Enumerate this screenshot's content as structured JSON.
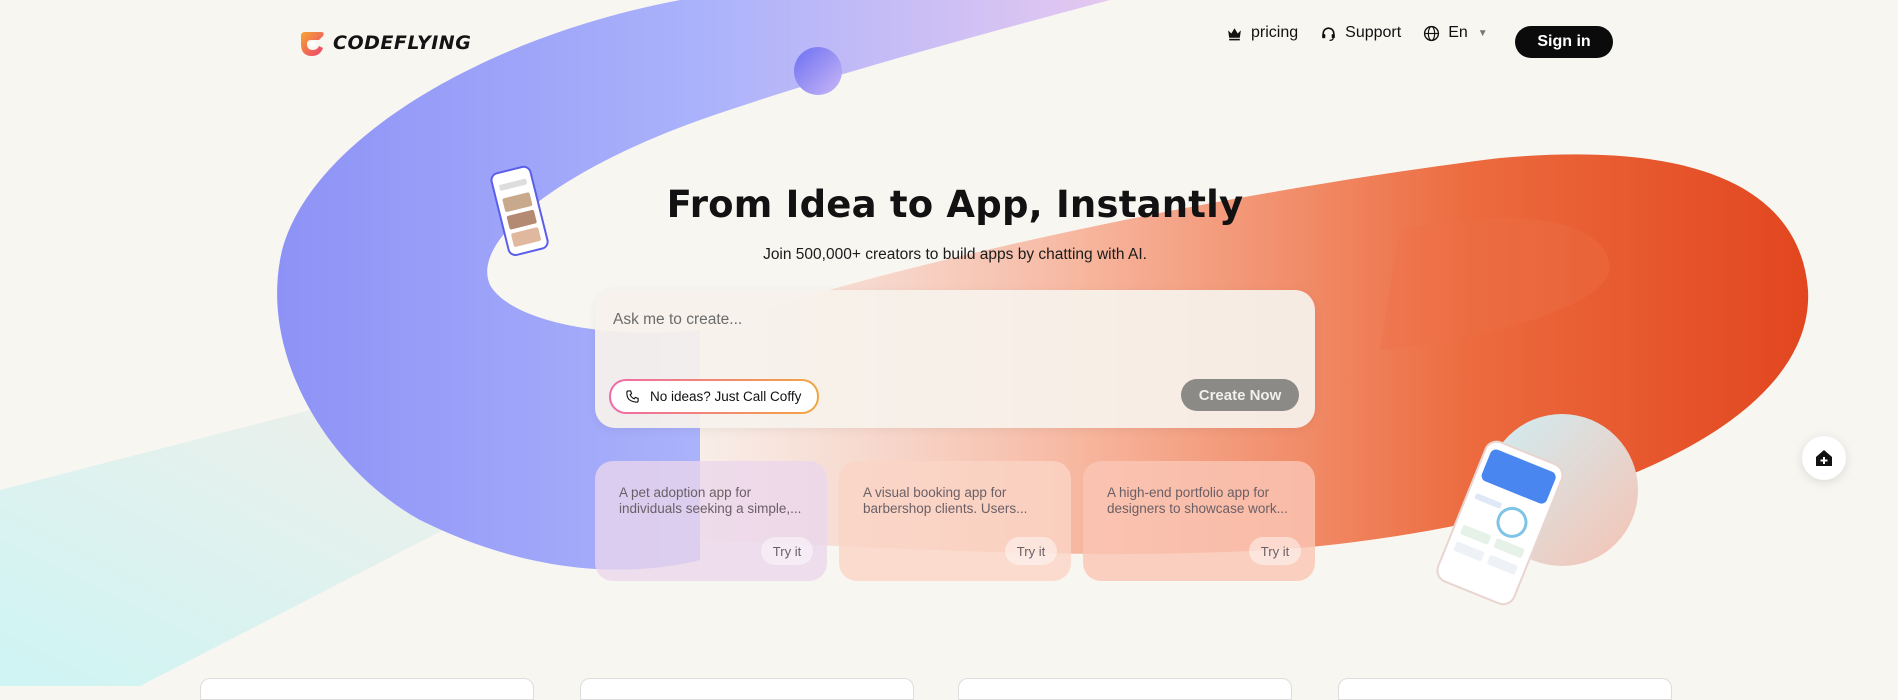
{
  "brand": {
    "name": "CODEFLYING"
  },
  "nav": {
    "pricing_label": "pricing",
    "support_label": "Support",
    "language_label": "En",
    "signin_label": "Sign in"
  },
  "hero": {
    "title": "From Idea to App, Instantly",
    "subtitle": "Join 500,000+ creators to build apps by chatting with AI."
  },
  "prompt": {
    "placeholder": "Ask me to create...",
    "value": "",
    "call_label": "No ideas? Just Call Coffy",
    "create_label": "Create Now"
  },
  "ideas": [
    {
      "text": "A pet adoption app for individuals seeking a simple,...",
      "action": "Try it"
    },
    {
      "text": "A visual booking app for barbershop clients. Users...",
      "action": "Try it"
    },
    {
      "text": "A high-end portfolio app for designers to showcase work...",
      "action": "Try it"
    }
  ],
  "icons": {
    "pricing": "crown-icon",
    "support": "headset-icon",
    "language": "globe-icon",
    "call": "phone-icon",
    "float": "home-plus-icon"
  },
  "colors": {
    "accent_blue": "#8f92f7",
    "accent_orange": "#e64a22",
    "sign_in_bg": "#0b0b0b",
    "create_btn_bg": "#8c8a86"
  }
}
